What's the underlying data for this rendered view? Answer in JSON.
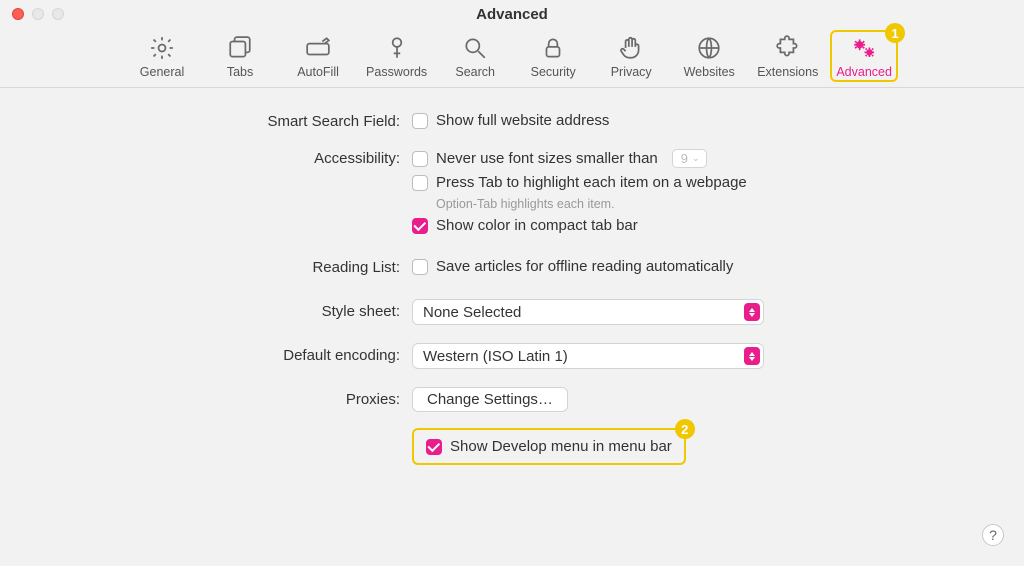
{
  "window": {
    "title": "Advanced"
  },
  "toolbar": {
    "items": [
      {
        "label": "General"
      },
      {
        "label": "Tabs"
      },
      {
        "label": "AutoFill"
      },
      {
        "label": "Passwords"
      },
      {
        "label": "Search"
      },
      {
        "label": "Security"
      },
      {
        "label": "Privacy"
      },
      {
        "label": "Websites"
      },
      {
        "label": "Extensions"
      },
      {
        "label": "Advanced"
      }
    ],
    "active_badge": "1"
  },
  "rows": {
    "smart_search": {
      "label": "Smart Search Field:",
      "option1": "Show full website address"
    },
    "accessibility": {
      "label": "Accessibility:",
      "option1": "Never use font sizes smaller than",
      "font_size_value": "9",
      "option2": "Press Tab to highlight each item on a webpage",
      "hint": "Option-Tab highlights each item.",
      "option3": "Show color in compact tab bar"
    },
    "reading_list": {
      "label": "Reading List:",
      "option1": "Save articles for offline reading automatically"
    },
    "style_sheet": {
      "label": "Style sheet:",
      "value": "None Selected"
    },
    "default_encoding": {
      "label": "Default encoding:",
      "value": "Western (ISO Latin 1)"
    },
    "proxies": {
      "label": "Proxies:",
      "button": "Change Settings…"
    },
    "develop": {
      "option": "Show Develop menu in menu bar",
      "badge": "2"
    }
  },
  "help": "?"
}
